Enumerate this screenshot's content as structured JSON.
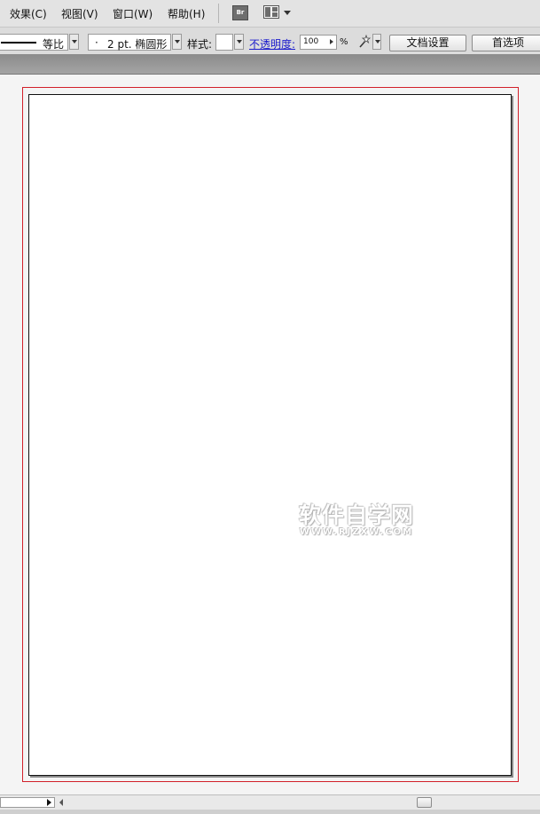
{
  "menubar": {
    "items": [
      {
        "label": "效果(C)"
      },
      {
        "label": "视图(V)"
      },
      {
        "label": "窗口(W)"
      },
      {
        "label": "帮助(H)"
      }
    ],
    "bridge_label": "Br"
  },
  "control": {
    "stroke_uniform_label": "等比",
    "brush_bullet": "·",
    "brush_value": "2 pt. 椭圆形",
    "style_label": "样式:",
    "opacity_label": "不透明度:",
    "opacity_value": "100",
    "opacity_unit": "%",
    "doc_setup_label": "文档设置",
    "preferences_label": "首选项"
  },
  "watermark": {
    "main": "软件自学网",
    "sub": "WWW.RJZXW.COM"
  },
  "colors": {
    "bleed_guide": "#d2202a",
    "opacity_link": "#1a1acc"
  }
}
